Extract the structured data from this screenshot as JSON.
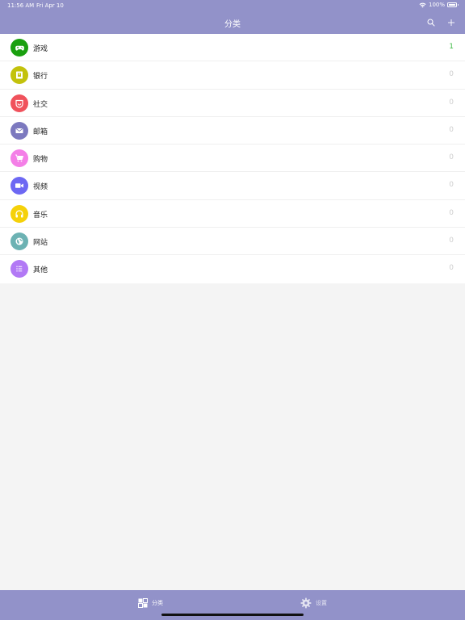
{
  "status_bar": {
    "time": "11:56 AM",
    "date": "Fri Apr 10",
    "battery": "100%"
  },
  "nav": {
    "title": "分类"
  },
  "categories": [
    {
      "label": "游戏",
      "count": "1",
      "color": "#1aa00f",
      "icon": "gamepad-icon"
    },
    {
      "label": "银行",
      "count": "0",
      "color": "#c3c20c",
      "icon": "bank-icon"
    },
    {
      "label": "社交",
      "count": "0",
      "color": "#f0525c",
      "icon": "social-icon"
    },
    {
      "label": "邮箱",
      "count": "0",
      "color": "#7c79bf",
      "icon": "mail-icon"
    },
    {
      "label": "购物",
      "count": "0",
      "color": "#f47fe7",
      "icon": "cart-icon"
    },
    {
      "label": "视频",
      "count": "0",
      "color": "#6d68f3",
      "icon": "video-icon"
    },
    {
      "label": "音乐",
      "count": "0",
      "color": "#f5d10a",
      "icon": "headphones-icon"
    },
    {
      "label": "网站",
      "count": "0",
      "color": "#6cb2b3",
      "icon": "globe-icon"
    },
    {
      "label": "其他",
      "count": "0",
      "color": "#b279f5",
      "icon": "list-icon"
    }
  ],
  "tabbar": {
    "categories_label": "分类",
    "settings_label": "设置"
  },
  "colors": {
    "brand": "#9292c9",
    "active_count": "#3cb943"
  }
}
